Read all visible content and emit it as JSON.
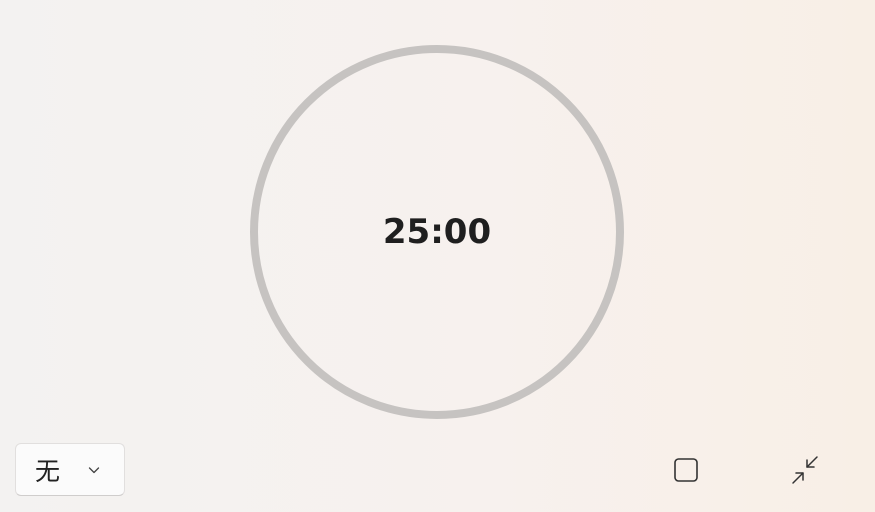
{
  "timer": {
    "remaining": "25:00"
  },
  "mode_dropdown": {
    "selected": "无"
  },
  "icons": {
    "dropdown": "chevron-down-icon",
    "square_button": "square-icon",
    "compact_button": "compact-overlay-icon"
  },
  "colors": {
    "ring": "#c6c3c1",
    "text": "#1f1f1f",
    "dropdown_background": "#fbfbfb",
    "dropdown_border": "#d9d7d6"
  }
}
